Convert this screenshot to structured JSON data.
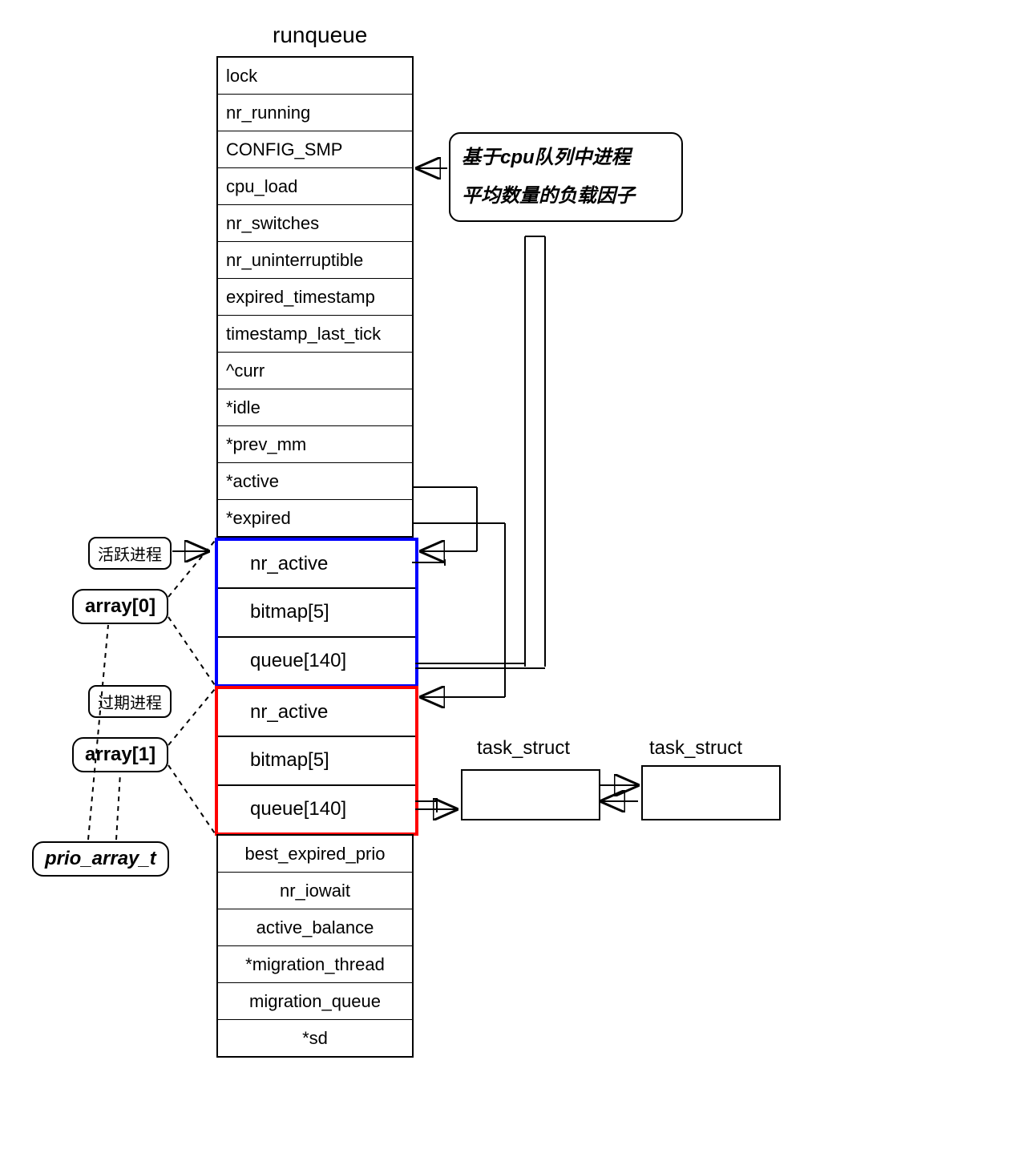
{
  "title": "runqueue",
  "fields_top": [
    "lock",
    "nr_running",
    "CONFIG_SMP",
    "cpu_load",
    "nr_switches",
    "nr_uninterruptible",
    "expired_timestamp",
    "timestamp_last_tick",
    "^curr",
    "*idle",
    "*prev_mm",
    "*active",
    "*expired"
  ],
  "array0": {
    "nr_active": "nr_active",
    "bitmap": "bitmap[5]",
    "queue": "queue[140]"
  },
  "array1": {
    "nr_active": "nr_active",
    "bitmap": "bitmap[5]",
    "queue": "queue[140]"
  },
  "fields_bottom": [
    "best_expired_prio",
    "nr_iowait",
    "active_balance",
    "*migration_thread",
    "migration_queue",
    "*sd"
  ],
  "annotations": {
    "cpu_load_note_line1": "基于cpu队列中进程",
    "cpu_load_note_line2": "平均数量的负载因子",
    "active_process": "活跃进程",
    "expired_process": "过期进程",
    "array0_label": "array[0]",
    "array1_label": "array[1]",
    "prio_array_label": "prio_array_t",
    "task_struct": "task_struct"
  },
  "colors": {
    "array0_border": "#0000ff",
    "array1_border": "#ff0000"
  }
}
